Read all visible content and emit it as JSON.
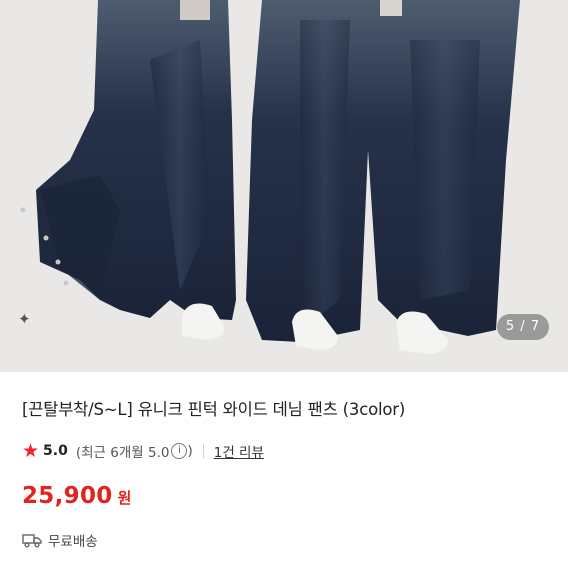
{
  "gallery": {
    "counter_current": "5",
    "counter_total": "7",
    "counter_text": "5 / 7",
    "accent_sparkle": "✦"
  },
  "product": {
    "title": "[끈탈부착/S~L] 유니크 핀턱 와이드 데님 팬츠 (3color)",
    "rating_score": "5.0",
    "rating_detail": "(최근 6개월 5.0",
    "rating_close": ")",
    "review_link": "1건 리뷰",
    "price": "25,900",
    "currency": "원",
    "shipping": "무료배송"
  },
  "icons": {
    "star": "star-icon",
    "info": "info-icon",
    "truck": "truck-icon",
    "sparkle": "sparkle-icon"
  },
  "colors": {
    "price": "#e0241f",
    "star": "#f2262e",
    "denim": "#1e2a44"
  }
}
